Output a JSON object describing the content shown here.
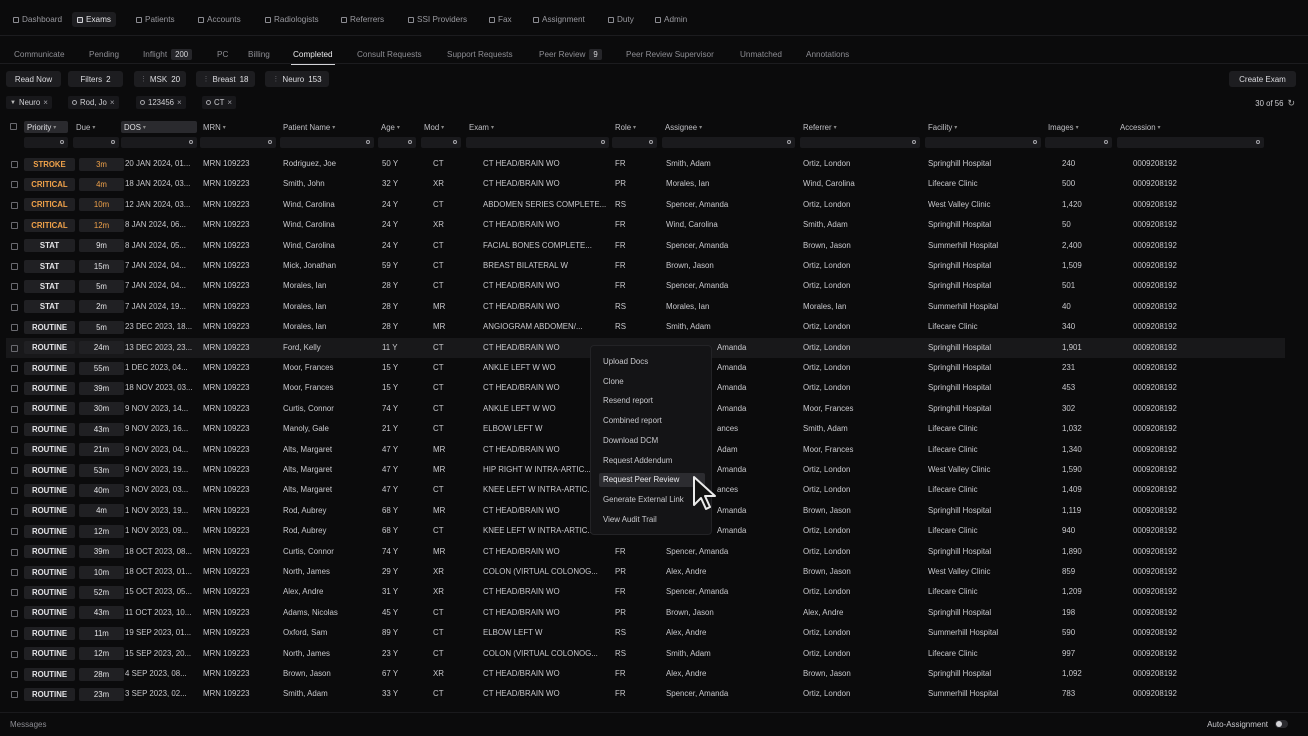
{
  "nav": [
    {
      "label": "Dashboard",
      "icon": "dashboard-icon"
    },
    {
      "label": "Exams",
      "icon": "exams-icon",
      "active": true
    },
    {
      "label": "Patients",
      "icon": "patients-icon"
    },
    {
      "label": "Accounts",
      "icon": "accounts-icon"
    },
    {
      "label": "Radiologists",
      "icon": "radiologists-icon"
    },
    {
      "label": "Referrers",
      "icon": "referrers-icon"
    },
    {
      "label": "SSI Providers",
      "icon": "ssi-providers-icon"
    },
    {
      "label": "Fax",
      "icon": "fax-icon"
    },
    {
      "label": "Assignment",
      "icon": "assignment-icon"
    },
    {
      "label": "Duty",
      "icon": "duty-icon"
    },
    {
      "label": "Admin",
      "icon": "admin-icon"
    }
  ],
  "tabs": [
    {
      "label": "Communicate"
    },
    {
      "label": "Pending"
    },
    {
      "label": "Inflight",
      "count": "200"
    },
    {
      "label": "PC"
    },
    {
      "label": "Billing"
    },
    {
      "label": "Completed",
      "active": true
    },
    {
      "label": "Consult Requests"
    },
    {
      "label": "Support Requests"
    },
    {
      "label": "Peer Review",
      "count": "9"
    },
    {
      "label": "Peer Review Supervisor"
    },
    {
      "label": "Unmatched"
    },
    {
      "label": "Annotations"
    }
  ],
  "toolbar": {
    "read_now": "Read Now",
    "filters": {
      "label": "Filters",
      "count": "2"
    },
    "worklists": [
      {
        "label": "MSK",
        "count": "20"
      },
      {
        "label": "Breast",
        "count": "18"
      },
      {
        "label": "Neuro",
        "count": "153"
      }
    ],
    "create_exam": "Create Exam"
  },
  "active_filters": [
    {
      "label": "Neuro",
      "icon": "filter-icon"
    },
    {
      "label": "Rod, Jo",
      "icon": "search-icon"
    },
    {
      "label": "123456",
      "icon": "search-icon"
    },
    {
      "label": "CT",
      "icon": "search-icon"
    }
  ],
  "result_count": "30 of 56",
  "columns": [
    "Priority",
    "Due",
    "DOS",
    "MRN",
    "Patient Name",
    "Age",
    "Mod",
    "Exam",
    "Role",
    "Assignee",
    "Referrer",
    "Facility",
    "Images",
    "Accession"
  ],
  "rows": [
    {
      "priority": "STROKE",
      "due": "3m",
      "dos": "20 JAN 2024, 01...",
      "mrn": "MRN 109223",
      "patient": "Rodriguez, Joe",
      "age": "50 Y",
      "mod": "CT",
      "exam": "CT HEAD/BRAIN WO",
      "role": "FR",
      "assignee": "Smith, Adam",
      "referrer": "Ortiz, London",
      "facility": "Springhill Hospital",
      "images": "240",
      "accession": "0009208192"
    },
    {
      "priority": "CRITICAL",
      "due": "4m",
      "dos": "18 JAN 2024, 03...",
      "mrn": "MRN 109223",
      "patient": "Smith, John",
      "age": "32 Y",
      "mod": "XR",
      "exam": "CT HEAD/BRAIN WO",
      "role": "PR",
      "assignee": "Morales, Ian",
      "referrer": "Wind, Carolina",
      "facility": "Lifecare Clinic",
      "images": "500",
      "accession": "0009208192"
    },
    {
      "priority": "CRITICAL",
      "due": "10m",
      "dos": "12 JAN 2024, 03...",
      "mrn": "MRN 109223",
      "patient": "Wind, Carolina",
      "age": "24 Y",
      "mod": "CT",
      "exam": "ABDOMEN SERIES COMPLETE...",
      "role": "RS",
      "assignee": "Spencer, Amanda",
      "referrer": "Ortiz, London",
      "facility": "West Valley Clinic",
      "images": "1,420",
      "accession": "0009208192"
    },
    {
      "priority": "CRITICAL",
      "due": "12m",
      "dos": "8 JAN 2024, 06...",
      "mrn": "MRN 109223",
      "patient": "Wind, Carolina",
      "age": "24 Y",
      "mod": "XR",
      "exam": "CT HEAD/BRAIN WO",
      "role": "FR",
      "assignee": "Wind, Carolina",
      "referrer": "Smith, Adam",
      "facility": "Springhill Hospital",
      "images": "50",
      "accession": "0009208192"
    },
    {
      "priority": "STAT",
      "due": "9m",
      "dos": "8 JAN 2024, 05...",
      "mrn": "MRN 109223",
      "patient": "Wind, Carolina",
      "age": "24 Y",
      "mod": "CT",
      "exam": "FACIAL BONES COMPLETE...",
      "role": "FR",
      "assignee": "Spencer, Amanda",
      "referrer": "Brown, Jason",
      "facility": "Summerhill Hospital",
      "images": "2,400",
      "accession": "0009208192"
    },
    {
      "priority": "STAT",
      "due": "15m",
      "dos": "7 JAN 2024, 04...",
      "mrn": "MRN 109223",
      "patient": "Mick, Jonathan",
      "age": "59 Y",
      "mod": "CT",
      "exam": "BREAST BILATERAL W",
      "role": "FR",
      "assignee": "Brown, Jason",
      "referrer": "Ortiz, London",
      "facility": "Springhill Hospital",
      "images": "1,509",
      "accession": "0009208192"
    },
    {
      "priority": "STAT",
      "due": "5m",
      "dos": "7 JAN 2024, 04...",
      "mrn": "MRN 109223",
      "patient": "Morales, Ian",
      "age": "28 Y",
      "mod": "CT",
      "exam": "CT HEAD/BRAIN WO",
      "role": "FR",
      "assignee": "Spencer, Amanda",
      "referrer": "Ortiz, London",
      "facility": "Springhill Hospital",
      "images": "501",
      "accession": "0009208192"
    },
    {
      "priority": "STAT",
      "due": "2m",
      "dos": "7 JAN 2024, 19...",
      "mrn": "MRN 109223",
      "patient": "Morales, Ian",
      "age": "28 Y",
      "mod": "MR",
      "exam": "CT HEAD/BRAIN WO",
      "role": "RS",
      "assignee": "Morales, Ian",
      "referrer": "Morales, Ian",
      "facility": "Summerhill Hospital",
      "images": "40",
      "accession": "0009208192"
    },
    {
      "priority": "ROUTINE",
      "due": "5m",
      "dos": "23 DEC 2023, 18...",
      "mrn": "MRN 109223",
      "patient": "Morales, Ian",
      "age": "28 Y",
      "mod": "MR",
      "exam": "ANGIOGRAM ABDOMEN/...",
      "role": "RS",
      "assignee": "Smith, Adam",
      "referrer": "Ortiz, London",
      "facility": "Lifecare Clinic",
      "images": "340",
      "accession": "0009208192"
    },
    {
      "priority": "ROUTINE",
      "due": "24m",
      "dos": "13 DEC 2023, 23...",
      "mrn": "MRN 109223",
      "patient": "Ford, Kelly",
      "age": "11 Y",
      "mod": "CT",
      "exam": "CT HEAD/BRAIN WO",
      "role": "",
      "assignee": "Amanda",
      "referrer": "Ortiz, London",
      "facility": "Springhill Hospital",
      "images": "1,901",
      "accession": "0009208192"
    },
    {
      "priority": "ROUTINE",
      "due": "55m",
      "dos": "1 DEC 2023, 04...",
      "mrn": "MRN 109223",
      "patient": "Moor, Frances",
      "age": "15 Y",
      "mod": "CT",
      "exam": "ANKLE LEFT W WO",
      "role": "",
      "assignee": "Amanda",
      "referrer": "Ortiz, London",
      "facility": "Springhill Hospital",
      "images": "231",
      "accession": "0009208192"
    },
    {
      "priority": "ROUTINE",
      "due": "39m",
      "dos": "18 NOV 2023, 03...",
      "mrn": "MRN 109223",
      "patient": "Moor, Frances",
      "age": "15 Y",
      "mod": "CT",
      "exam": "CT HEAD/BRAIN WO",
      "role": "",
      "assignee": "Amanda",
      "referrer": "Ortiz, London",
      "facility": "Springhill Hospital",
      "images": "453",
      "accession": "0009208192"
    },
    {
      "priority": "ROUTINE",
      "due": "30m",
      "dos": "9 NOV 2023, 14...",
      "mrn": "MRN 109223",
      "patient": "Curtis, Connor",
      "age": "74 Y",
      "mod": "CT",
      "exam": "ANKLE LEFT W WO",
      "role": "",
      "assignee": "Amanda",
      "referrer": "Moor, Frances",
      "facility": "Springhill Hospital",
      "images": "302",
      "accession": "0009208192"
    },
    {
      "priority": "ROUTINE",
      "due": "43m",
      "dos": "9 NOV 2023, 16...",
      "mrn": "MRN 109223",
      "patient": "Manoly, Gale",
      "age": "21 Y",
      "mod": "CT",
      "exam": "ELBOW LEFT W",
      "role": "",
      "assignee": "ances",
      "referrer": "Smith, Adam",
      "facility": "Lifecare Clinic",
      "images": "1,032",
      "accession": "0009208192"
    },
    {
      "priority": "ROUTINE",
      "due": "21m",
      "dos": "9 NOV 2023, 04...",
      "mrn": "MRN 109223",
      "patient": "Alts, Margaret",
      "age": "47 Y",
      "mod": "MR",
      "exam": "CT HEAD/BRAIN WO",
      "role": "",
      "assignee": "Adam",
      "referrer": "Moor, Frances",
      "facility": "Lifecare Clinic",
      "images": "1,340",
      "accession": "0009208192"
    },
    {
      "priority": "ROUTINE",
      "due": "53m",
      "dos": "9 NOV 2023, 19...",
      "mrn": "MRN 109223",
      "patient": "Alts, Margaret",
      "age": "47 Y",
      "mod": "MR",
      "exam": "HIP RIGHT W INTRA-ARTIC...",
      "role": "",
      "assignee": "Amanda",
      "referrer": "Ortiz, London",
      "facility": "West Valley Clinic",
      "images": "1,590",
      "accession": "0009208192"
    },
    {
      "priority": "ROUTINE",
      "due": "40m",
      "dos": "3 NOV 2023, 03...",
      "mrn": "MRN 109223",
      "patient": "Alts, Margaret",
      "age": "47 Y",
      "mod": "CT",
      "exam": "KNEE LEFT W INTRA-ARTIC...",
      "role": "",
      "assignee": "ances",
      "referrer": "Ortiz, London",
      "facility": "Lifecare Clinic",
      "images": "1,409",
      "accession": "0009208192"
    },
    {
      "priority": "ROUTINE",
      "due": "4m",
      "dos": "1 NOV 2023, 19...",
      "mrn": "MRN 109223",
      "patient": "Rod, Aubrey",
      "age": "68 Y",
      "mod": "MR",
      "exam": "CT HEAD/BRAIN WO",
      "role": "",
      "assignee": "Amanda",
      "referrer": "Brown, Jason",
      "facility": "Springhill Hospital",
      "images": "1,119",
      "accession": "0009208192"
    },
    {
      "priority": "ROUTINE",
      "due": "12m",
      "dos": "1 NOV 2023, 09...",
      "mrn": "MRN 109223",
      "patient": "Rod, Aubrey",
      "age": "68 Y",
      "mod": "CT",
      "exam": "KNEE LEFT W INTRA-ARTIC...",
      "role": "",
      "assignee": "Amanda",
      "referrer": "Ortiz, London",
      "facility": "Lifecare Clinic",
      "images": "940",
      "accession": "0009208192"
    },
    {
      "priority": "ROUTINE",
      "due": "39m",
      "dos": "18 OCT 2023, 08...",
      "mrn": "MRN 109223",
      "patient": "Curtis, Connor",
      "age": "74 Y",
      "mod": "MR",
      "exam": "CT HEAD/BRAIN WO",
      "role": "FR",
      "assignee": "Spencer, Amanda",
      "referrer": "Ortiz, London",
      "facility": "Springhill Hospital",
      "images": "1,890",
      "accession": "0009208192"
    },
    {
      "priority": "ROUTINE",
      "due": "10m",
      "dos": "18 OCT 2023, 01...",
      "mrn": "MRN 109223",
      "patient": "North, James",
      "age": "29 Y",
      "mod": "XR",
      "exam": "COLON (VIRTUAL COLONOG...",
      "role": "PR",
      "assignee": "Alex, Andre",
      "referrer": "Brown, Jason",
      "facility": "West Valley Clinic",
      "images": "859",
      "accession": "0009208192"
    },
    {
      "priority": "ROUTINE",
      "due": "52m",
      "dos": "15 OCT 2023, 05...",
      "mrn": "MRN 109223",
      "patient": "Alex, Andre",
      "age": "31 Y",
      "mod": "XR",
      "exam": "CT HEAD/BRAIN WO",
      "role": "FR",
      "assignee": "Spencer, Amanda",
      "referrer": "Ortiz, London",
      "facility": "Lifecare Clinic",
      "images": "1,209",
      "accession": "0009208192"
    },
    {
      "priority": "ROUTINE",
      "due": "43m",
      "dos": "11 OCT 2023, 10...",
      "mrn": "MRN 109223",
      "patient": "Adams, Nicolas",
      "age": "45 Y",
      "mod": "CT",
      "exam": "CT HEAD/BRAIN WO",
      "role": "PR",
      "assignee": "Brown, Jason",
      "referrer": "Alex, Andre",
      "facility": "Springhill Hospital",
      "images": "198",
      "accession": "0009208192"
    },
    {
      "priority": "ROUTINE",
      "due": "11m",
      "dos": "19 SEP 2023, 01...",
      "mrn": "MRN 109223",
      "patient": "Oxford, Sam",
      "age": "89 Y",
      "mod": "CT",
      "exam": "ELBOW LEFT W",
      "role": "RS",
      "assignee": "Alex, Andre",
      "referrer": "Ortiz, London",
      "facility": "Summerhill Hospital",
      "images": "590",
      "accession": "0009208192"
    },
    {
      "priority": "ROUTINE",
      "due": "12m",
      "dos": "15 SEP 2023, 20...",
      "mrn": "MRN 109223",
      "patient": "North, James",
      "age": "23 Y",
      "mod": "CT",
      "exam": "COLON (VIRTUAL COLONOG...",
      "role": "RS",
      "assignee": "Smith, Adam",
      "referrer": "Ortiz, London",
      "facility": "Lifecare Clinic",
      "images": "997",
      "accession": "0009208192"
    },
    {
      "priority": "ROUTINE",
      "due": "28m",
      "dos": "4 SEP 2023, 08...",
      "mrn": "MRN 109223",
      "patient": "Brown, Jason",
      "age": "67 Y",
      "mod": "XR",
      "exam": "CT HEAD/BRAIN WO",
      "role": "FR",
      "assignee": "Alex, Andre",
      "referrer": "Brown, Jason",
      "facility": "Springhill Hospital",
      "images": "1,092",
      "accession": "0009208192"
    },
    {
      "priority": "ROUTINE",
      "due": "23m",
      "dos": "3 SEP 2023, 02...",
      "mrn": "MRN 109223",
      "patient": "Smith, Adam",
      "age": "33 Y",
      "mod": "CT",
      "exam": "CT HEAD/BRAIN WO",
      "role": "FR",
      "assignee": "Spencer, Amanda",
      "referrer": "Ortiz, London",
      "facility": "Summerhill Hospital",
      "images": "783",
      "accession": "0009208192"
    }
  ],
  "context_menu": [
    {
      "label": "Upload Docs"
    },
    {
      "label": "Clone"
    },
    {
      "label": "Resend report"
    },
    {
      "label": "Combined report"
    },
    {
      "label": "Download DCM"
    },
    {
      "label": "Request Addendum"
    },
    {
      "label": "Request Peer Review",
      "highlighted": true
    },
    {
      "label": "Generate External Link"
    },
    {
      "label": "View Audit Trail"
    }
  ],
  "footer": {
    "messages": "Messages",
    "auto_assignment": "Auto-Assignment"
  },
  "colors": {
    "warning": "#f0a24a",
    "background": "#0b0b0c"
  }
}
